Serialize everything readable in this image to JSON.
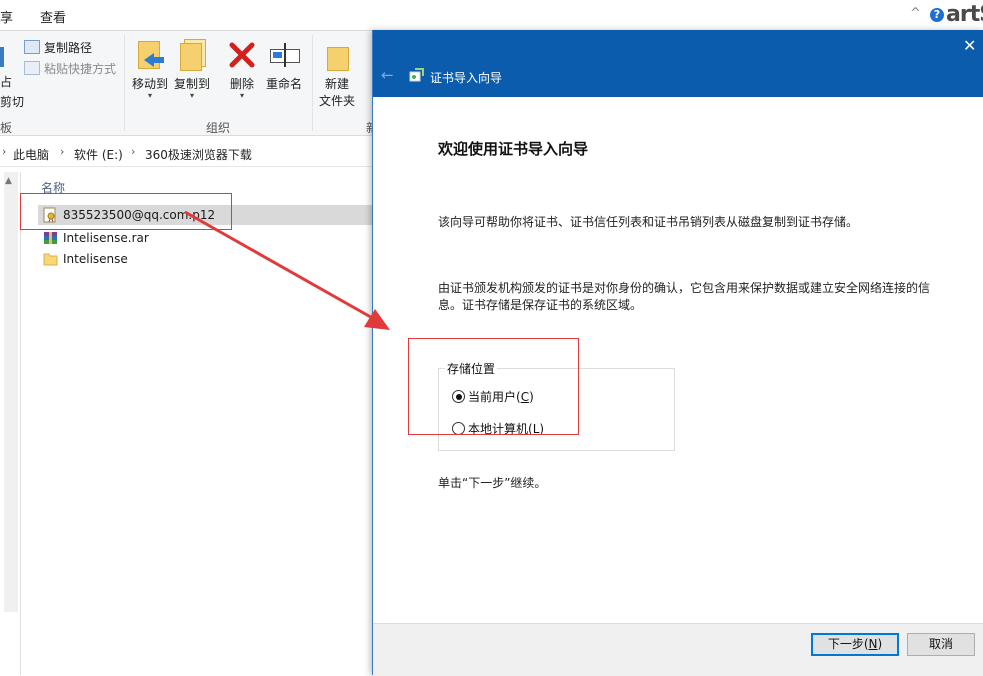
{
  "ribbon": {
    "tabs": [
      "享",
      "查看"
    ],
    "clipboard": {
      "copy_path": "复制路径",
      "paste_shortcut": "粘贴快捷方式",
      "cut_fragment": "剪切",
      "group_label_fragment": "板",
      "left_fragment_1": "占"
    },
    "organize": {
      "move_to": "移动到",
      "copy_to": "复制到",
      "delete": "删除",
      "rename": "重命名",
      "group_label": "组织"
    },
    "new": {
      "new_folder_line1": "新建",
      "new_folder_line2": "文件夹",
      "group_label_fragment": "新"
    },
    "right_controls": {
      "collapse_glyph": "^",
      "help_glyph": "?",
      "brand_fragment": "artS"
    }
  },
  "address": {
    "crumbs": [
      "此电脑",
      "软件 (E:)",
      "360极速浏览器下载"
    ]
  },
  "files": {
    "column_name": "名称",
    "items": [
      {
        "name": "835523500@qq.com.p12",
        "icon": "certificate-file-icon",
        "selected": true
      },
      {
        "name": "Intelisense.rar",
        "icon": "rar-archive-icon",
        "selected": false
      },
      {
        "name": "Intelisense",
        "icon": "folder-icon",
        "selected": false
      }
    ]
  },
  "dialog": {
    "title": "证书导入向导",
    "close_glyph": "✕",
    "back_glyph": "←",
    "heading": "欢迎使用证书导入向导",
    "para1": "该向导可帮助你将证书、证书信任列表和证书吊销列表从磁盘复制到证书存储。",
    "para2": "由证书颁发机构颁发的证书是对你身份的确认，它包含用来保护数据或建立安全网络连接的信息。证书存储是保存证书的系统区域。",
    "store_location_legend": "存储位置",
    "option_current_user": {
      "label": "当前用户(",
      "hotkey": "C",
      "suffix": ")",
      "checked": true
    },
    "option_local_machine": {
      "label": "本地计算机(",
      "hotkey": "L",
      "suffix": ")",
      "checked": false
    },
    "hint": "单击“下一步”继续。",
    "next_button": {
      "label": "下一步(",
      "hotkey": "N",
      "suffix": ")"
    },
    "cancel_button": "取消"
  },
  "colors": {
    "dialog_header": "#0b5cad",
    "annotation_red": "#e23a3a",
    "selection_gray": "#d9d9d9"
  }
}
